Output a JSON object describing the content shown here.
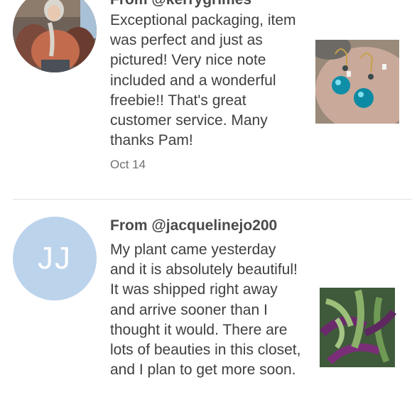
{
  "reviews": [
    {
      "from_label": "From @kerrygrimes",
      "text": "Exceptional packaging, item was perfect and just as pictured! Very nice note included and a wonderful freebie!! That's great customer service. Many thanks Pam!",
      "date": "Oct 14",
      "avatar_type": "photo",
      "product_image": "turquoise-bead-earrings"
    },
    {
      "from_label": "From @jacquelinejo200",
      "initials": "JJ",
      "text": "My plant came yesterday and it is absolutely beautiful! It was shipped right away and arrive sooner than I thought it would. There are lots of beauties in this closet, and I plan to get more soon.",
      "avatar_type": "initials",
      "product_image": "purple-green-plant"
    }
  ],
  "colors": {
    "avatar_initials_bg": "#bcd3ec",
    "divider": "#e2e2e2",
    "text": "#3f3f3f",
    "date": "#707070"
  }
}
